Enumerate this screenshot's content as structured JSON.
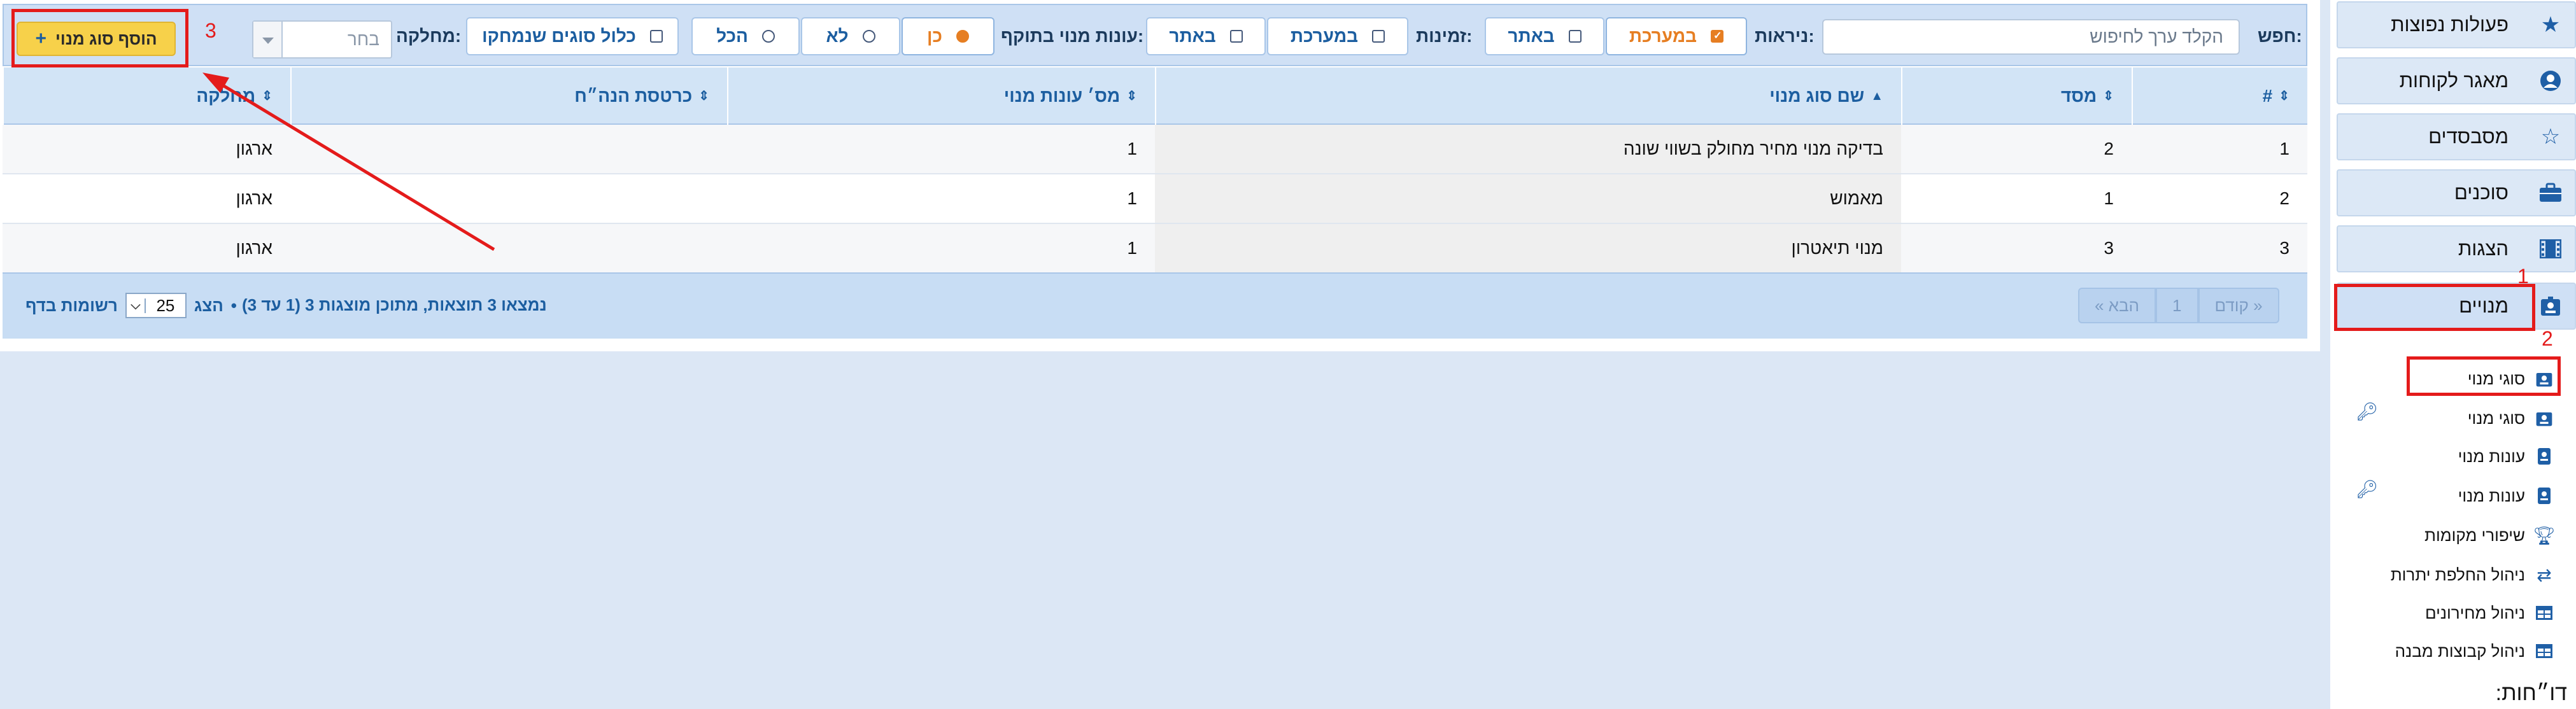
{
  "filters": {
    "search_label": "חפש:",
    "search_placeholder": "הקלד ערך לחיפוש",
    "visibility_label": "ניראות:",
    "visibility_options": [
      "במערכת",
      "באתר"
    ],
    "availability_label": "זמינות:",
    "availability_options": [
      "במערכת",
      "באתר"
    ],
    "season_label": "עונות מנוי בתוקף:",
    "season_options": [
      "כן",
      "לא",
      "הכל"
    ],
    "include_deleted_label": "כלול סוגים שנמחקו",
    "department_label": "מחלקה:",
    "department_placeholder": "בחר",
    "add_button_label": "הוסף סוג מנוי"
  },
  "annotations": [
    "1",
    "2",
    "3"
  ],
  "table": {
    "columns": [
      "#",
      "מסד",
      "שם סוג מנוי",
      "מס׳ עונות מנוי",
      "כרטסת הנה״ח",
      "מחלקה"
    ],
    "rows": [
      {
        "index": "1",
        "id": "2",
        "name": "בדיקה מנוי מחיר מחולק בשווי שונה",
        "seasons": "1",
        "ledger": "",
        "department": "ארגון"
      },
      {
        "index": "2",
        "id": "1",
        "name": "מאמוש",
        "seasons": "1",
        "ledger": "",
        "department": "ארגון"
      },
      {
        "index": "3",
        "id": "3",
        "name": "מנוי תיאטרון",
        "seasons": "1",
        "ledger": "",
        "department": "ארגון"
      }
    ]
  },
  "footer": {
    "prev_label": "« קודם",
    "current_page": "1",
    "next_label": "הבא »",
    "results_text": "נמצאו 3 תוצאות, מתוכן מוצגות 3 (1 עד 3)",
    "bullet": "•",
    "show_label": "הצג",
    "page_size": "25",
    "per_page_label": "רשומות בדף"
  },
  "sidebar": {
    "items": [
      {
        "label": "פעולות נפוצות",
        "icon": "star-icon"
      },
      {
        "label": "מאגר לקוחות",
        "icon": "user-circle-icon"
      },
      {
        "label": "מסבסדים",
        "icon": "star-outline-icon"
      },
      {
        "label": "סוכנים",
        "icon": "briefcase-icon"
      },
      {
        "label": "הצגות",
        "icon": "film-icon"
      },
      {
        "label": "מנויים",
        "icon": "id-badge-icon"
      }
    ],
    "sub_items": [
      {
        "label": "סוגי מנוי",
        "icon": "id-badge-icon"
      },
      {
        "label": "סוגי מנוי",
        "icon": "id-badge-icon"
      },
      {
        "label": "עונות מנוי",
        "icon": "id-card-icon"
      },
      {
        "label": "עונות מנוי",
        "icon": "id-card-icon"
      },
      {
        "label": "שיפורי מקומות",
        "icon": "trophy-icon"
      },
      {
        "label": "ניהול החלפת יתרות",
        "icon": "exchange-icon"
      },
      {
        "label": "ניהול מחירונים",
        "icon": "table-icon"
      },
      {
        "label": "ניהול קבוצות מבנה",
        "icon": "table-icon"
      }
    ],
    "reports_heading": "דו״חות:"
  },
  "colors": {
    "accent_orange": "#e67e22",
    "primary_blue": "#1c5ea0",
    "annotation_red": "#e41b1b",
    "add_button_yellow": "#f7d14a"
  }
}
